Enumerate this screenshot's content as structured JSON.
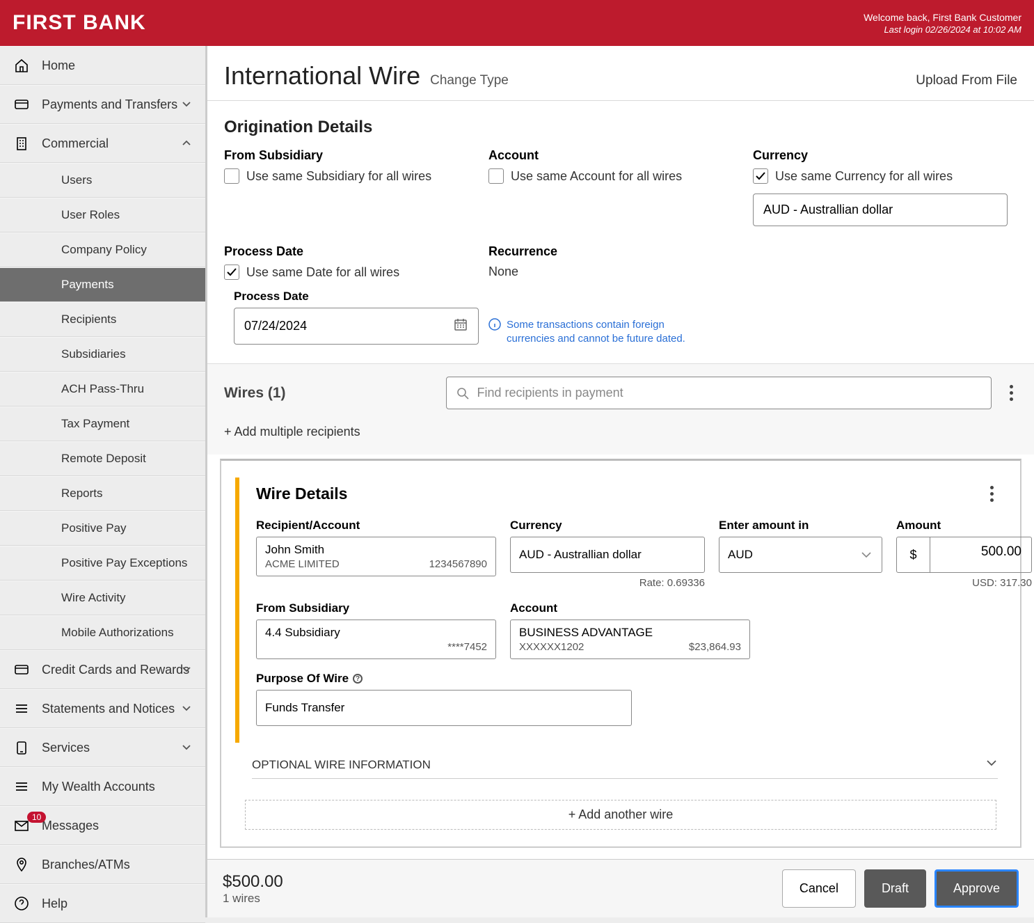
{
  "header": {
    "logo": "FIRST BANK",
    "welcome": "Welcome back, First Bank Customer",
    "last_login": "Last login 02/26/2024 at 10:02 AM"
  },
  "sidebar": {
    "home": "Home",
    "payments_transfers": "Payments and Transfers",
    "commercial": "Commercial",
    "commercial_sub": {
      "users": "Users",
      "user_roles": "User Roles",
      "company_policy": "Company Policy",
      "payments": "Payments",
      "recipients": "Recipients",
      "subsidiaries": "Subsidiaries",
      "ach_pass": "ACH Pass-Thru",
      "tax_payment": "Tax Payment",
      "remote_deposit": "Remote Deposit",
      "reports": "Reports",
      "positive_pay": "Positive Pay",
      "positive_pay_exc": "Positive Pay Exceptions",
      "wire_activity": "Wire Activity",
      "mobile_auth": "Mobile Authorizations"
    },
    "credit_cards": "Credit Cards and Rewards",
    "statements": "Statements and Notices",
    "services": "Services",
    "wealth": "My Wealth Accounts",
    "messages": "Messages",
    "messages_badge": "10",
    "branches": "Branches/ATMs",
    "help": "Help"
  },
  "page": {
    "title": "International Wire",
    "change_type": "Change Type",
    "upload": "Upload From File",
    "orig_section": "Origination Details",
    "from_sub": "From Subsidiary",
    "from_sub_chk": "Use same Subsidiary for all wires",
    "account": "Account",
    "account_chk": "Use same Account for all wires",
    "currency": "Currency",
    "currency_chk": "Use same Currency for all wires",
    "currency_val": "AUD - Australlian dollar",
    "process_date": "Process Date",
    "process_date_chk": "Use same Date for all wires",
    "process_date_sub": "Process Date",
    "process_date_val": "07/24/2024",
    "recurrence": "Recurrence",
    "recurrence_val": "None",
    "info_text": "Some transactions contain foreign currencies and cannot be future dated.",
    "wires_heading": "Wires (1)",
    "search_placeholder": "Find recipients in payment",
    "add_multiple": "+ Add multiple recipients",
    "add_another": "+ Add another wire",
    "optional_wire_info": "OPTIONAL WIRE INFORMATION"
  },
  "wire": {
    "section": "Wire Details",
    "recip_label": "Recipient/Account",
    "recip_name": "John Smith",
    "recip_co": "ACME LIMITED",
    "recip_num": "1234567890",
    "currency_label": "Currency",
    "currency_val": "AUD - Australlian dollar",
    "rate": "Rate: 0.69336",
    "amount_in_label": "Enter amount in",
    "amount_in_val": "AUD",
    "amount_label": "Amount",
    "amount_sym": "$",
    "amount_val": "500.00",
    "usd_note": "USD: 317.30",
    "from_sub_label": "From Subsidiary",
    "from_sub_name": "4.4 Subsidiary",
    "from_sub_mask": "****7452",
    "account_label": "Account",
    "account_name": "BUSINESS ADVANTAGE",
    "account_mask": "XXXXXX1202",
    "account_bal": "$23,864.93",
    "purpose_label": "Purpose Of Wire",
    "purpose_val": "Funds Transfer"
  },
  "footer": {
    "total": "$500.00",
    "count": "1 wires",
    "cancel": "Cancel",
    "draft": "Draft",
    "approve": "Approve"
  }
}
